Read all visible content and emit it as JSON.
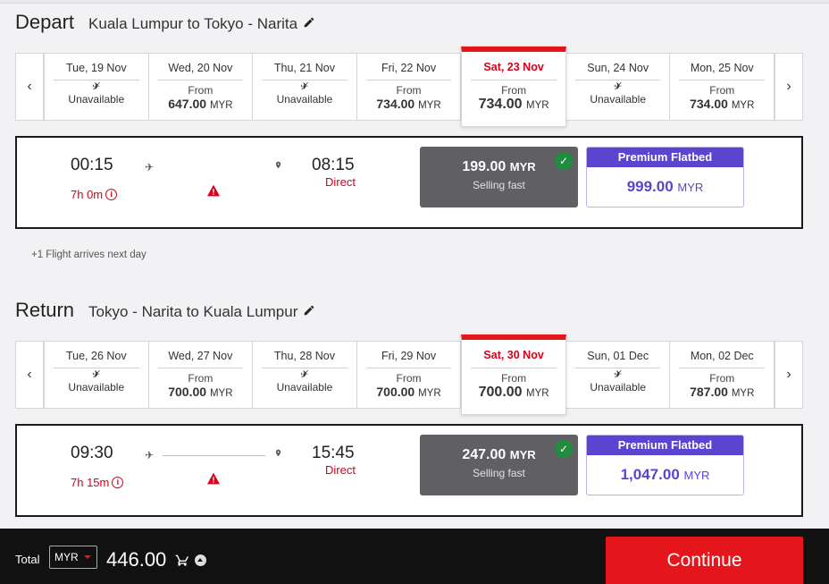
{
  "depart": {
    "label": "Depart",
    "route": "Kuala Lumpur to Tokyo - Narita",
    "dates": [
      {
        "day": "Tue, 19 Nov",
        "unavailable": "Unavailable"
      },
      {
        "day": "Wed, 20 Nov",
        "from": "From",
        "price": "647.00",
        "currency": "MYR"
      },
      {
        "day": "Thu, 21 Nov",
        "unavailable": "Unavailable"
      },
      {
        "day": "Fri, 22 Nov",
        "from": "From",
        "price": "734.00",
        "currency": "MYR"
      },
      {
        "day": "Sat, 23 Nov",
        "from": "From",
        "price": "734.00",
        "currency": "MYR",
        "selected": true
      },
      {
        "day": "Sun, 24 Nov",
        "unavailable": "Unavailable"
      },
      {
        "day": "Mon, 25 Nov",
        "from": "From",
        "price": "734.00",
        "currency": "MYR"
      }
    ],
    "flight": {
      "depart_time": "00:15",
      "duration": "7h 0m",
      "arrive_time": "08:15",
      "stops": "Direct",
      "economy": {
        "price": "199.00",
        "currency": "MYR",
        "note": "Selling fast"
      },
      "premium": {
        "title": "Premium Flatbed",
        "price": "999.00",
        "currency": "MYR"
      }
    }
  },
  "note": "+1 Flight arrives next day",
  "return": {
    "label": "Return",
    "route": "Tokyo - Narita to Kuala Lumpur",
    "dates": [
      {
        "day": "Tue, 26 Nov",
        "unavailable": "Unavailable"
      },
      {
        "day": "Wed, 27 Nov",
        "from": "From",
        "price": "700.00",
        "currency": "MYR"
      },
      {
        "day": "Thu, 28 Nov",
        "unavailable": "Unavailable"
      },
      {
        "day": "Fri, 29 Nov",
        "from": "From",
        "price": "700.00",
        "currency": "MYR"
      },
      {
        "day": "Sat, 30 Nov",
        "from": "From",
        "price": "700.00",
        "currency": "MYR",
        "selected": true
      },
      {
        "day": "Sun, 01 Dec",
        "unavailable": "Unavailable"
      },
      {
        "day": "Mon, 02 Dec",
        "from": "From",
        "price": "787.00",
        "currency": "MYR"
      }
    ],
    "flight": {
      "depart_time": "09:30",
      "duration": "7h 15m",
      "arrive_time": "15:45",
      "stops": "Direct",
      "economy": {
        "price": "247.00",
        "currency": "MYR",
        "note": "Selling fast"
      },
      "premium": {
        "title": "Premium Flatbed",
        "price": "1,047.00",
        "currency": "MYR"
      }
    }
  },
  "footer": {
    "total_label": "Total",
    "currency": "MYR",
    "amount": "446.00",
    "continue_label": "Continue"
  },
  "colors": {
    "brand_red": "#e4161b",
    "premium_purple": "#5a44d0",
    "selected_green": "#1e8e3e"
  },
  "icons": {
    "prev": "chevron-left-icon",
    "next": "chevron-right-icon",
    "edit": "pencil-icon",
    "plane": "plane-icon",
    "pin": "location-pin-icon",
    "warning": "warning-icon",
    "info": "info-icon",
    "check": "check-icon",
    "cart": "cart-icon",
    "expand": "chevron-up-icon"
  }
}
